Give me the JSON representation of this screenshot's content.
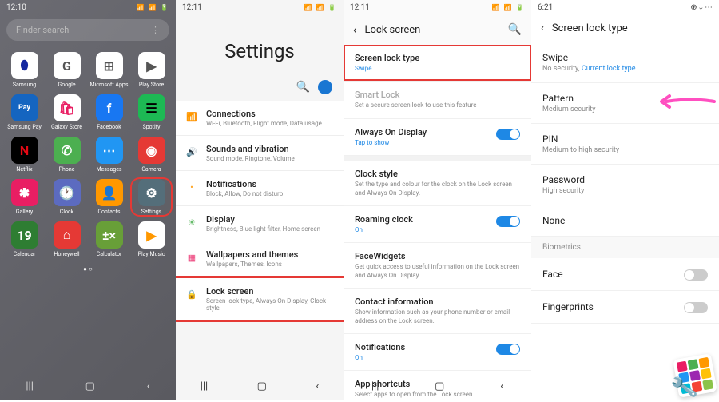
{
  "p1": {
    "time": "12:10",
    "search_placeholder": "Finder search",
    "apps": [
      {
        "label": "Samsung",
        "bg": "#fff",
        "fg": "#1428a0",
        "glyph": "⬮"
      },
      {
        "label": "Google",
        "bg": "#fff",
        "fg": "#555",
        "glyph": "G"
      },
      {
        "label": "Microsoft Apps",
        "bg": "#fff",
        "fg": "#555",
        "glyph": "⊞"
      },
      {
        "label": "Play Store",
        "bg": "#fff",
        "fg": "#555",
        "glyph": "▶"
      },
      {
        "label": "Samsung Pay",
        "bg": "#1565c0",
        "fg": "#fff",
        "glyph": "Pay"
      },
      {
        "label": "Galaxy Store",
        "bg": "#fff",
        "fg": "#e91e63",
        "glyph": "🛍"
      },
      {
        "label": "Facebook",
        "bg": "#1877f2",
        "fg": "#fff",
        "glyph": "f"
      },
      {
        "label": "Spotify",
        "bg": "#1db954",
        "fg": "#000",
        "glyph": "☰"
      },
      {
        "label": "Netflix",
        "bg": "#000",
        "fg": "#e50914",
        "glyph": "N"
      },
      {
        "label": "Phone",
        "bg": "#4caf50",
        "fg": "#fff",
        "glyph": "✆"
      },
      {
        "label": "Messages",
        "bg": "#2196f3",
        "fg": "#fff",
        "glyph": "⋯"
      },
      {
        "label": "Camera",
        "bg": "#e53935",
        "fg": "#fff",
        "glyph": "◉"
      },
      {
        "label": "Gallery",
        "bg": "#e91e63",
        "fg": "#fff",
        "glyph": "✱"
      },
      {
        "label": "Clock",
        "bg": "#5c6bc0",
        "fg": "#fff",
        "glyph": "🕐"
      },
      {
        "label": "Contacts",
        "bg": "#ff9800",
        "fg": "#fff",
        "glyph": "👤"
      },
      {
        "label": "Settings",
        "bg": "#546e7a",
        "fg": "#fff",
        "glyph": "⚙",
        "hl": true
      },
      {
        "label": "Calendar",
        "bg": "#2e7d32",
        "fg": "#fff",
        "glyph": "19"
      },
      {
        "label": "Honeywell",
        "bg": "#e53935",
        "fg": "#fff",
        "glyph": "⌂"
      },
      {
        "label": "Calculator",
        "bg": "#689f38",
        "fg": "#fff",
        "glyph": "±×"
      },
      {
        "label": "Play Music",
        "bg": "#fff",
        "fg": "#ff9800",
        "glyph": "▶"
      }
    ]
  },
  "p2": {
    "time": "12:11",
    "title": "Settings",
    "items": [
      {
        "icon": "📶",
        "color": "#42a5f5",
        "title": "Connections",
        "sub": "Wi-Fi, Bluetooth, Flight mode, Data usage"
      },
      {
        "icon": "🔊",
        "color": "#ab47bc",
        "title": "Sounds and vibration",
        "sub": "Sound mode, Ringtone, Volume"
      },
      {
        "icon": "•",
        "color": "#ffa726",
        "title": "Notifications",
        "sub": "Block, Allow, Do not disturb"
      },
      {
        "icon": "☀",
        "color": "#66bb6a",
        "title": "Display",
        "sub": "Brightness, Blue light filter, Home screen"
      },
      {
        "icon": "▦",
        "color": "#ec407a",
        "title": "Wallpapers and themes",
        "sub": "Wallpapers, Themes, Icons",
        "red": true
      },
      {
        "icon": "🔒",
        "color": "#7e57c2",
        "title": "Lock screen",
        "sub": "Screen lock type, Always On Display, Clock style",
        "red": true
      }
    ]
  },
  "p3": {
    "time": "12:11",
    "header": "Lock screen",
    "items": [
      {
        "title": "Screen lock type",
        "sub": "Swipe",
        "blue": true,
        "box": true
      },
      {
        "title": "Smart Lock",
        "sub": "Set a secure screen lock to use this feature",
        "disabled": true
      },
      {
        "title": "Always On Display",
        "sub": "Tap to show",
        "blue": true,
        "toggle": true
      },
      {
        "gap": true
      },
      {
        "title": "Clock style",
        "sub": "Set the type and colour for the clock on the Lock screen and Always On Display."
      },
      {
        "title": "Roaming clock",
        "sub": "On",
        "blue": true,
        "toggle": true
      },
      {
        "title": "FaceWidgets",
        "sub": "Get quick access to useful information on the Lock screen and Always On Display."
      },
      {
        "title": "Contact information",
        "sub": "Show information such as your phone number or email address on the Lock screen."
      },
      {
        "title": "Notifications",
        "sub": "On",
        "blue": true,
        "toggle": true
      },
      {
        "title": "App shortcuts",
        "sub": "Select apps to open from the Lock screen."
      }
    ]
  },
  "p4": {
    "time": "6:21",
    "header": "Screen lock type",
    "swipe": {
      "title": "Swipe",
      "sub": "No security, ",
      "link": "Current lock type"
    },
    "pattern": {
      "title": "Pattern",
      "sub": "Medium security"
    },
    "pin": {
      "title": "PIN",
      "sub": "Medium to high security"
    },
    "password": {
      "title": "Password",
      "sub": "High security"
    },
    "none": {
      "title": "None"
    },
    "bio_header": "Biometrics",
    "face": "Face",
    "finger": "Fingerprints"
  }
}
